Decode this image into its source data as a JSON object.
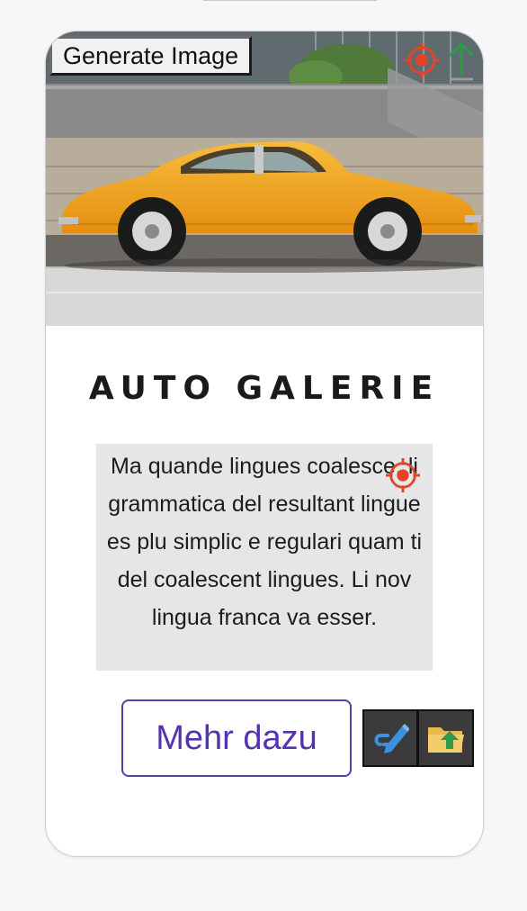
{
  "hero": {
    "generate_label": "Generate Image",
    "target_icon": "crosshair-target-icon",
    "upload_icon": "arrow-up-icon"
  },
  "content": {
    "title": "AUTO GALERIE",
    "body": "Ma quande lingues coalesce, li grammatica del resultant lingue es plu simplic e regulari quam ti del coalescent lingues. Li nov lingua franca va esser.",
    "more_label": "Mehr dazu"
  },
  "toolbar": {
    "edit_icon": "pen-link-icon",
    "folder_icon": "folder-upload-icon"
  },
  "colors": {
    "accent": "#5533b0",
    "target": "#e0452a",
    "upload_arrow": "#2e9a4a",
    "edit_icon": "#3d8fe0",
    "car": "#f2a51f"
  }
}
